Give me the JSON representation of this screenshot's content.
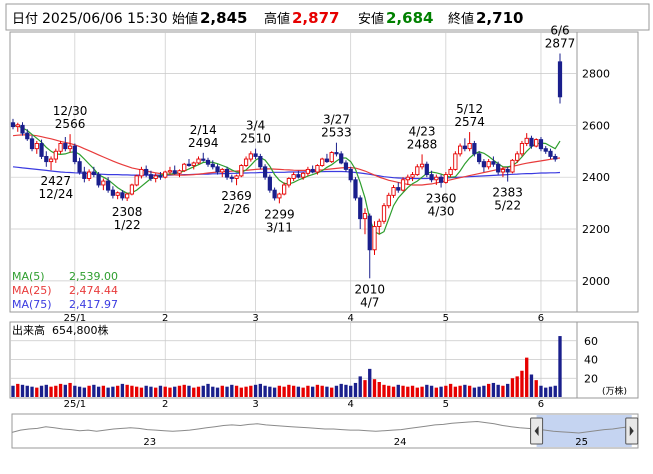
{
  "header": {
    "date_label": "日付",
    "date": "2025/06/06 15:30",
    "open_label": "始値",
    "open": "2,845",
    "high_label": "高値",
    "high": "2,877",
    "low_label": "安値",
    "low": "2,684",
    "close_label": "終値",
    "close": "2,710"
  },
  "colors": {
    "up": "#e60000",
    "down": "#1a1f8c",
    "ma5": "#2e9e2e",
    "ma25": "#e83b3b",
    "ma75": "#3a3ae0",
    "high_text": "#e60000",
    "low_text": "#008000",
    "grid": "#c8c8c8",
    "nav_fill": "#b7c9ee"
  },
  "legend": [
    {
      "label": "MA(5)",
      "value": "2,539.00",
      "color": "#2e9e2e"
    },
    {
      "label": "MA(25)",
      "value": "2,474.44",
      "color": "#e83b3b"
    },
    {
      "label": "MA(75)",
      "value": "2,417.97",
      "color": "#3a3ae0"
    }
  ],
  "chart_data": {
    "type": "candlestick",
    "y_ticks": [
      "2800",
      "2600",
      "2400",
      "2200",
      "2000"
    ],
    "ylim": [
      1880,
      2960
    ],
    "x_ticks": [
      {
        "label": "25/1",
        "index": 13
      },
      {
        "label": "2",
        "index": 32
      },
      {
        "label": "3",
        "index": 51
      },
      {
        "label": "4",
        "index": 71
      },
      {
        "label": "5",
        "index": 91
      },
      {
        "label": "6",
        "index": 111
      }
    ],
    "annotations": [
      {
        "lines": [
          "12/30",
          "2566"
        ],
        "index": 12,
        "value": 2566,
        "pos": "above"
      },
      {
        "lines": [
          "2427",
          "12/24"
        ],
        "index": 9,
        "value": 2427,
        "pos": "below"
      },
      {
        "lines": [
          "2308",
          "1/22"
        ],
        "index": 24,
        "value": 2308,
        "pos": "below"
      },
      {
        "lines": [
          "2/14",
          "2494"
        ],
        "index": 40,
        "value": 2494,
        "pos": "above"
      },
      {
        "lines": [
          "2369",
          "2/26"
        ],
        "index": 47,
        "value": 2369,
        "pos": "below"
      },
      {
        "lines": [
          "3/4",
          "2510"
        ],
        "index": 51,
        "value": 2510,
        "pos": "above"
      },
      {
        "lines": [
          "2299",
          "3/11"
        ],
        "index": 56,
        "value": 2299,
        "pos": "below"
      },
      {
        "lines": [
          "3/27",
          "2533"
        ],
        "index": 68,
        "value": 2533,
        "pos": "above"
      },
      {
        "lines": [
          "2010",
          "4/7"
        ],
        "index": 75,
        "value": 2010,
        "pos": "below"
      },
      {
        "lines": [
          "4/23",
          "2488"
        ],
        "index": 86,
        "value": 2488,
        "pos": "above"
      },
      {
        "lines": [
          "2360",
          "4/30"
        ],
        "index": 90,
        "value": 2360,
        "pos": "below"
      },
      {
        "lines": [
          "5/12",
          "2574"
        ],
        "index": 96,
        "value": 2574,
        "pos": "above"
      },
      {
        "lines": [
          "2383",
          "5/22"
        ],
        "index": 104,
        "value": 2383,
        "pos": "below"
      },
      {
        "lines": [
          "6/6",
          "2877"
        ],
        "index": 115,
        "value": 2877,
        "pos": "above"
      }
    ],
    "candles": [
      [
        2610,
        2625,
        2585,
        2595
      ],
      [
        2595,
        2610,
        2575,
        2602
      ],
      [
        2600,
        2612,
        2560,
        2570
      ],
      [
        2570,
        2585,
        2540,
        2548
      ],
      [
        2548,
        2560,
        2500,
        2510
      ],
      [
        2510,
        2540,
        2490,
        2530
      ],
      [
        2530,
        2545,
        2470,
        2480
      ],
      [
        2480,
        2500,
        2440,
        2460
      ],
      [
        2460,
        2480,
        2427,
        2470
      ],
      [
        2470,
        2510,
        2455,
        2500
      ],
      [
        2500,
        2540,
        2490,
        2530
      ],
      [
        2530,
        2555,
        2500,
        2510
      ],
      [
        2510,
        2566,
        2495,
        2520
      ],
      [
        2520,
        2530,
        2450,
        2460
      ],
      [
        2460,
        2475,
        2410,
        2420
      ],
      [
        2420,
        2440,
        2380,
        2395
      ],
      [
        2395,
        2430,
        2385,
        2420
      ],
      [
        2420,
        2440,
        2400,
        2410
      ],
      [
        2410,
        2420,
        2360,
        2370
      ],
      [
        2370,
        2395,
        2350,
        2385
      ],
      [
        2385,
        2400,
        2340,
        2350
      ],
      [
        2350,
        2365,
        2318,
        2330
      ],
      [
        2330,
        2345,
        2315,
        2340
      ],
      [
        2340,
        2350,
        2310,
        2320
      ],
      [
        2320,
        2340,
        2308,
        2335
      ],
      [
        2335,
        2375,
        2330,
        2370
      ],
      [
        2370,
        2410,
        2365,
        2405
      ],
      [
        2405,
        2440,
        2395,
        2430
      ],
      [
        2430,
        2445,
        2400,
        2410
      ],
      [
        2410,
        2425,
        2385,
        2395
      ],
      [
        2395,
        2415,
        2380,
        2405
      ],
      [
        2405,
        2420,
        2390,
        2400
      ],
      [
        2400,
        2425,
        2395,
        2420
      ],
      [
        2420,
        2440,
        2410,
        2425
      ],
      [
        2425,
        2445,
        2410,
        2415
      ],
      [
        2415,
        2430,
        2400,
        2425
      ],
      [
        2425,
        2455,
        2420,
        2450
      ],
      [
        2450,
        2470,
        2440,
        2445
      ],
      [
        2445,
        2460,
        2430,
        2455
      ],
      [
        2455,
        2480,
        2450,
        2470
      ],
      [
        2470,
        2494,
        2460,
        2465
      ],
      [
        2465,
        2475,
        2440,
        2450
      ],
      [
        2450,
        2465,
        2430,
        2440
      ],
      [
        2440,
        2450,
        2410,
        2420
      ],
      [
        2420,
        2435,
        2400,
        2430
      ],
      [
        2430,
        2440,
        2390,
        2400
      ],
      [
        2400,
        2410,
        2380,
        2395
      ],
      [
        2395,
        2410,
        2369,
        2405
      ],
      [
        2405,
        2450,
        2400,
        2445
      ],
      [
        2445,
        2480,
        2440,
        2470
      ],
      [
        2470,
        2500,
        2460,
        2490
      ],
      [
        2490,
        2510,
        2470,
        2480
      ],
      [
        2480,
        2490,
        2430,
        2440
      ],
      [
        2440,
        2450,
        2390,
        2400
      ],
      [
        2400,
        2410,
        2340,
        2350
      ],
      [
        2350,
        2360,
        2310,
        2320
      ],
      [
        2320,
        2340,
        2299,
        2335
      ],
      [
        2335,
        2380,
        2330,
        2370
      ],
      [
        2370,
        2400,
        2360,
        2395
      ],
      [
        2395,
        2420,
        2385,
        2410
      ],
      [
        2410,
        2425,
        2395,
        2400
      ],
      [
        2400,
        2420,
        2390,
        2415
      ],
      [
        2415,
        2440,
        2405,
        2430
      ],
      [
        2430,
        2445,
        2415,
        2420
      ],
      [
        2420,
        2450,
        2410,
        2445
      ],
      [
        2445,
        2475,
        2440,
        2470
      ],
      [
        2470,
        2490,
        2455,
        2460
      ],
      [
        2460,
        2500,
        2455,
        2495
      ],
      [
        2495,
        2533,
        2480,
        2490
      ],
      [
        2490,
        2500,
        2450,
        2455
      ],
      [
        2455,
        2465,
        2420,
        2430
      ],
      [
        2430,
        2440,
        2380,
        2390
      ],
      [
        2390,
        2400,
        2310,
        2320
      ],
      [
        2320,
        2330,
        2200,
        2240
      ],
      [
        2240,
        2280,
        2180,
        2260
      ],
      [
        2250,
        2260,
        2010,
        2120
      ],
      [
        2120,
        2230,
        2100,
        2210
      ],
      [
        2210,
        2240,
        2180,
        2230
      ],
      [
        2230,
        2300,
        2220,
        2290
      ],
      [
        2290,
        2340,
        2280,
        2330
      ],
      [
        2330,
        2370,
        2320,
        2360
      ],
      [
        2360,
        2380,
        2340,
        2350
      ],
      [
        2350,
        2400,
        2345,
        2390
      ],
      [
        2390,
        2410,
        2370,
        2400
      ],
      [
        2400,
        2420,
        2385,
        2410
      ],
      [
        2410,
        2450,
        2405,
        2440
      ],
      [
        2440,
        2488,
        2430,
        2450
      ],
      [
        2450,
        2460,
        2400,
        2410
      ],
      [
        2410,
        2425,
        2380,
        2390
      ],
      [
        2390,
        2410,
        2370,
        2400
      ],
      [
        2400,
        2410,
        2360,
        2380
      ],
      [
        2380,
        2420,
        2375,
        2410
      ],
      [
        2410,
        2440,
        2400,
        2430
      ],
      [
        2430,
        2500,
        2425,
        2490
      ],
      [
        2490,
        2530,
        2480,
        2520
      ],
      [
        2520,
        2550,
        2500,
        2510
      ],
      [
        2510,
        2574,
        2500,
        2530
      ],
      [
        2530,
        2540,
        2480,
        2490
      ],
      [
        2490,
        2500,
        2450,
        2460
      ],
      [
        2460,
        2470,
        2420,
        2440
      ],
      [
        2440,
        2470,
        2430,
        2460
      ],
      [
        2460,
        2480,
        2440,
        2450
      ],
      [
        2450,
        2460,
        2410,
        2420
      ],
      [
        2420,
        2440,
        2400,
        2430
      ],
      [
        2430,
        2440,
        2383,
        2420
      ],
      [
        2420,
        2470,
        2415,
        2465
      ],
      [
        2465,
        2500,
        2455,
        2490
      ],
      [
        2490,
        2540,
        2480,
        2530
      ],
      [
        2530,
        2570,
        2520,
        2550
      ],
      [
        2550,
        2560,
        2510,
        2520
      ],
      [
        2520,
        2550,
        2515,
        2545
      ],
      [
        2545,
        2555,
        2500,
        2510
      ],
      [
        2510,
        2520,
        2490,
        2500
      ],
      [
        2500,
        2510,
        2470,
        2480
      ],
      [
        2480,
        2490,
        2460,
        2470
      ],
      [
        2845,
        2877,
        2684,
        2710
      ]
    ],
    "ma5": [
      2600,
      2597,
      2590,
      2580,
      2565,
      2550,
      2535,
      2515,
      2500,
      2490,
      2488,
      2490,
      2496,
      2498,
      2488,
      2470,
      2451,
      2432,
      2410,
      2400,
      2390,
      2375,
      2360,
      2348,
      2338,
      2340,
      2350,
      2365,
      2380,
      2395,
      2400,
      2408,
      2412,
      2412,
      2414,
      2418,
      2424,
      2432,
      2440,
      2448,
      2457,
      2458,
      2457,
      2452,
      2445,
      2438,
      2428,
      2420,
      2418,
      2428,
      2446,
      2466,
      2476,
      2466,
      2442,
      2410,
      2388,
      2376,
      2374,
      2380,
      2389,
      2396,
      2404,
      2410,
      2416,
      2425,
      2438,
      2448,
      2462,
      2474,
      2474,
      2460,
      2430,
      2380,
      2320,
      2240,
      2190,
      2180,
      2190,
      2240,
      2290,
      2320,
      2340,
      2360,
      2375,
      2385,
      2400,
      2415,
      2420,
      2417,
      2412,
      2405,
      2400,
      2402,
      2424,
      2452,
      2474,
      2490,
      2498,
      2492,
      2480,
      2466,
      2452,
      2440,
      2440,
      2444,
      2458,
      2478,
      2500,
      2518,
      2528,
      2532,
      2530,
      2520,
      2510,
      2539
    ],
    "ma25": [
      2560,
      2562,
      2563,
      2563,
      2562,
      2560,
      2556,
      2552,
      2548,
      2543,
      2538,
      2534,
      2530,
      2525,
      2518,
      2510,
      2502,
      2494,
      2486,
      2478,
      2470,
      2462,
      2455,
      2448,
      2442,
      2436,
      2432,
      2428,
      2424,
      2420,
      2417,
      2414,
      2412,
      2410,
      2409,
      2408,
      2408,
      2409,
      2410,
      2412,
      2414,
      2416,
      2418,
      2420,
      2421,
      2422,
      2423,
      2424,
      2425,
      2426,
      2428,
      2430,
      2431,
      2432,
      2432,
      2431,
      2430,
      2429,
      2428,
      2427,
      2426,
      2426,
      2426,
      2426,
      2427,
      2428,
      2430,
      2432,
      2434,
      2436,
      2437,
      2437,
      2435,
      2430,
      2424,
      2416,
      2408,
      2400,
      2394,
      2388,
      2384,
      2380,
      2376,
      2372,
      2370,
      2370,
      2370,
      2372,
      2374,
      2378,
      2382,
      2386,
      2390,
      2394,
      2398,
      2402,
      2406,
      2410,
      2414,
      2418,
      2422,
      2426,
      2430,
      2434,
      2438,
      2442,
      2446,
      2450,
      2454,
      2457,
      2460,
      2463,
      2466,
      2469,
      2472,
      2474
    ],
    "ma75": [
      2440,
      2438,
      2436,
      2434,
      2432,
      2430,
      2428,
      2426,
      2424,
      2422,
      2420,
      2419,
      2418,
      2417,
      2416,
      2415,
      2414,
      2413,
      2412,
      2411,
      2410,
      2410,
      2410,
      2409,
      2409,
      2408,
      2408,
      2408,
      2408,
      2408,
      2408,
      2408,
      2408,
      2408,
      2409,
      2409,
      2410,
      2410,
      2411,
      2411,
      2412,
      2412,
      2413,
      2413,
      2414,
      2414,
      2415,
      2415,
      2416,
      2416,
      2417,
      2417,
      2418,
      2418,
      2418,
      2419,
      2419,
      2419,
      2420,
      2420,
      2420,
      2420,
      2421,
      2421,
      2421,
      2421,
      2422,
      2422,
      2422,
      2422,
      2421,
      2420,
      2418,
      2416,
      2414,
      2411,
      2408,
      2405,
      2402,
      2400,
      2398,
      2397,
      2396,
      2395,
      2395,
      2395,
      2395,
      2395,
      2396,
      2396,
      2397,
      2397,
      2398,
      2399,
      2400,
      2401,
      2402,
      2403,
      2404,
      2405,
      2406,
      2407,
      2408,
      2409,
      2410,
      2411,
      2412,
      2413,
      2414,
      2414,
      2415,
      2416,
      2416,
      2417,
      2417,
      2418
    ],
    "volume": {
      "label": "出来高",
      "value": "654,800株",
      "unit": "(万株)",
      "y_ticks": [
        "60",
        "40",
        "20"
      ],
      "ylim": [
        0,
        80
      ],
      "values": [
        12,
        14,
        13,
        12,
        11,
        10,
        12,
        13,
        11,
        12,
        14,
        13,
        15,
        12,
        11,
        10,
        12,
        13,
        11,
        12,
        10,
        11,
        12,
        14,
        13,
        12,
        11,
        10,
        12,
        11,
        10,
        12,
        11,
        10,
        11,
        12,
        13,
        12,
        10,
        11,
        12,
        14,
        11,
        10,
        12,
        11,
        13,
        12,
        10,
        11,
        12,
        13,
        14,
        12,
        11,
        10,
        12,
        11,
        13,
        12,
        11,
        10,
        12,
        11,
        13,
        12,
        11,
        10,
        12,
        14,
        13,
        12,
        15,
        22,
        18,
        30,
        19,
        16,
        13,
        12,
        11,
        13,
        12,
        11,
        12,
        10,
        11,
        13,
        12,
        10,
        11,
        12,
        14,
        11,
        12,
        13,
        12,
        10,
        11,
        12,
        14,
        15,
        13,
        12,
        14,
        20,
        22,
        28,
        42,
        24,
        18,
        12,
        10,
        11,
        12,
        65
      ]
    },
    "navigator": {
      "labels": [
        {
          "label": "23",
          "pos": 0.22
        },
        {
          "label": "24",
          "pos": 0.62
        },
        {
          "label": "25",
          "pos": 0.91
        }
      ],
      "window": [
        0.838,
        0.99
      ],
      "profile": [
        20,
        24,
        26,
        27,
        30,
        28,
        26,
        25,
        23,
        24,
        22,
        24,
        26,
        27,
        28,
        27,
        25,
        24,
        23,
        22,
        23,
        24,
        26,
        28,
        30,
        32,
        33,
        32,
        34,
        35,
        33,
        32,
        31,
        30,
        29,
        28,
        27,
        26,
        26,
        25,
        24,
        24,
        23,
        22,
        23,
        24,
        25,
        27,
        29,
        31,
        33,
        34,
        36,
        37,
        38,
        39,
        37,
        35,
        32,
        30,
        28,
        27,
        26,
        24,
        22,
        21,
        20,
        19,
        21,
        23,
        25,
        26,
        28,
        30,
        32
      ]
    }
  }
}
